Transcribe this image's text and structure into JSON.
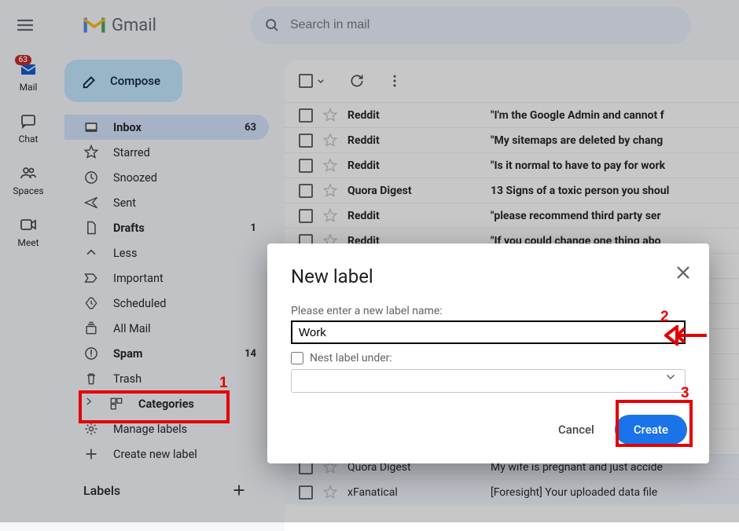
{
  "app": {
    "name": "Gmail"
  },
  "search": {
    "placeholder": "Search in mail"
  },
  "rail": {
    "mail": "Mail",
    "chat": "Chat",
    "spaces": "Spaces",
    "meet": "Meet",
    "mail_badge": "63"
  },
  "compose": "Compose",
  "nav": [
    {
      "id": "inbox",
      "label": "Inbox",
      "count": "63",
      "active": true,
      "bold": true,
      "icon": "inbox"
    },
    {
      "id": "starred",
      "label": "Starred",
      "icon": "star"
    },
    {
      "id": "snoozed",
      "label": "Snoozed",
      "icon": "clock"
    },
    {
      "id": "sent",
      "label": "Sent",
      "icon": "send"
    },
    {
      "id": "drafts",
      "label": "Drafts",
      "count": "1",
      "bold": true,
      "icon": "file"
    },
    {
      "id": "less",
      "label": "Less",
      "icon": "chev-up"
    },
    {
      "id": "important",
      "label": "Important",
      "icon": "important"
    },
    {
      "id": "scheduled",
      "label": "Scheduled",
      "icon": "sched"
    },
    {
      "id": "allmail",
      "label": "All Mail",
      "icon": "stack"
    },
    {
      "id": "spam",
      "label": "Spam",
      "count": "14",
      "bold": true,
      "icon": "spam"
    },
    {
      "id": "trash",
      "label": "Trash",
      "icon": "trash"
    },
    {
      "id": "categories",
      "label": "Categories",
      "bold": true,
      "icon": "cat"
    },
    {
      "id": "manage",
      "label": "Manage labels",
      "icon": "gear"
    },
    {
      "id": "create",
      "label": "Create new label",
      "icon": "plus"
    }
  ],
  "labels_head": "Labels",
  "rows": [
    {
      "sender": "Reddit",
      "subject": "\"I'm the Google Admin and cannot f"
    },
    {
      "sender": "Reddit",
      "subject": "\"My sitemaps are deleted by chang"
    },
    {
      "sender": "Reddit",
      "subject": "\"Is it normal to have to pay for work"
    },
    {
      "sender": "Quora Digest",
      "subject": "13 Signs of a toxic person you shoul"
    },
    {
      "sender": "Reddit",
      "subject": "\"please recommend third party ser"
    },
    {
      "sender": "Reddit",
      "subject": "\"If you could change one thing abo"
    },
    {
      "sender": "",
      "subject": ""
    },
    {
      "sender": "",
      "subject": ""
    },
    {
      "sender": "",
      "subject": ""
    },
    {
      "sender": "",
      "subject": ""
    },
    {
      "sender": "",
      "subject": ""
    },
    {
      "sender": "",
      "subject": ""
    },
    {
      "sender": "",
      "subject": ""
    },
    {
      "sender": "",
      "subject": ""
    },
    {
      "sender": "Quora Digest",
      "subject": "My wife is pregnant and just accide",
      "read": true
    },
    {
      "sender": "xFanatical",
      "subject": "[Foresight] Your uploaded data file",
      "read": true
    }
  ],
  "modal": {
    "title": "New label",
    "prompt": "Please enter a new label name:",
    "value": "Work",
    "nest_label": "Nest label under:",
    "cancel": "Cancel",
    "create": "Create"
  },
  "annotation": {
    "n1": "1",
    "n2": "2",
    "n3": "3"
  }
}
